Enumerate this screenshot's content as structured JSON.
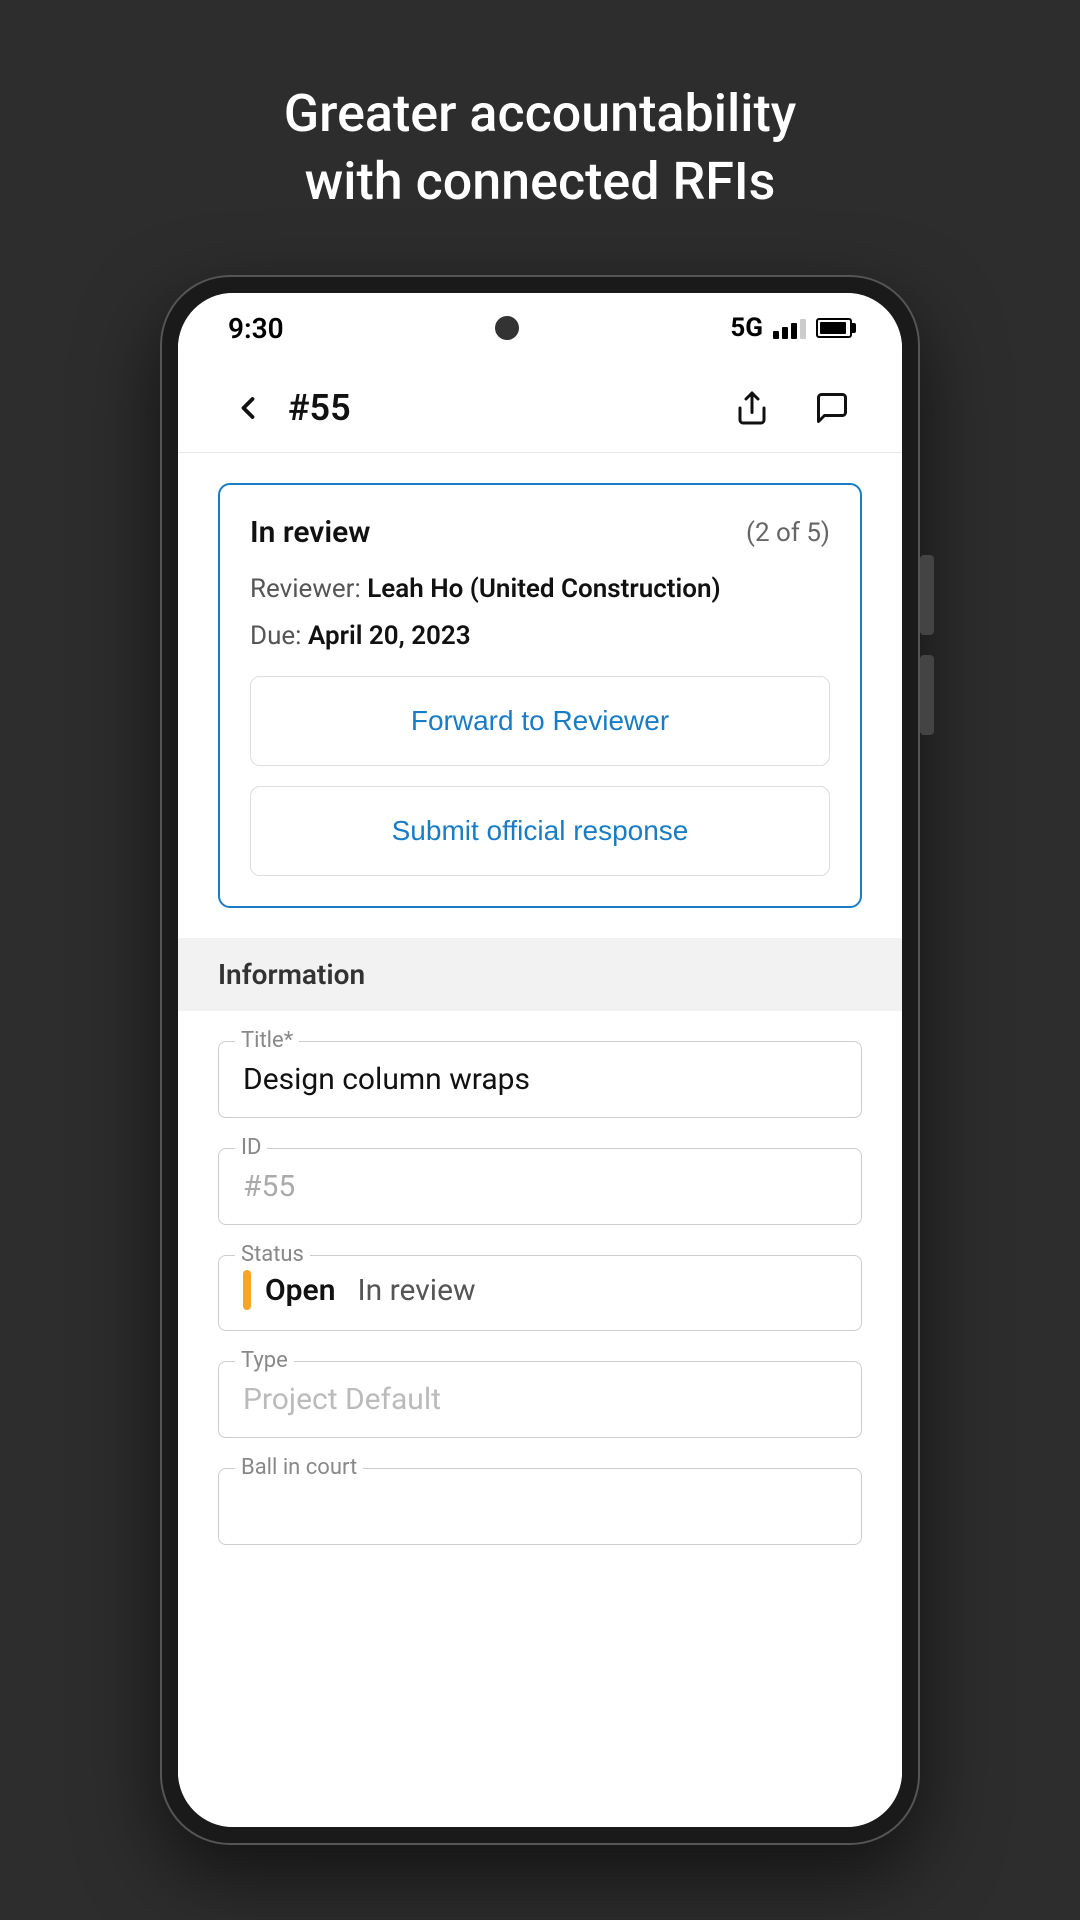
{
  "page": {
    "background_title_line1": "Greater accountability",
    "background_title_line2": "with connected RFIs"
  },
  "status_bar": {
    "time": "9:30",
    "network": "5G"
  },
  "top_nav": {
    "title": "#55",
    "back_label": "back",
    "share_label": "share",
    "comment_label": "comment"
  },
  "review_card": {
    "status": "In review",
    "count": "(2 of 5)",
    "reviewer_label": "Reviewer:",
    "reviewer_name": "Leah Ho (United Construction)",
    "due_label": "Due:",
    "due_date": "April 20, 2023",
    "forward_btn": "Forward to Reviewer",
    "submit_btn": "Submit official response"
  },
  "information_section": {
    "header": "Information",
    "fields": [
      {
        "label": "Title*",
        "value": "Design column wraps",
        "placeholder": false,
        "type": "title"
      },
      {
        "label": "ID",
        "value": "#55",
        "placeholder": true,
        "type": "id"
      },
      {
        "label": "Status",
        "value_open": "Open",
        "value_sub": "In review",
        "type": "status"
      },
      {
        "label": "Type",
        "value": "Project Default",
        "placeholder": true,
        "type": "type"
      },
      {
        "label": "Ball in court",
        "value": "",
        "placeholder": true,
        "type": "ball"
      }
    ]
  }
}
